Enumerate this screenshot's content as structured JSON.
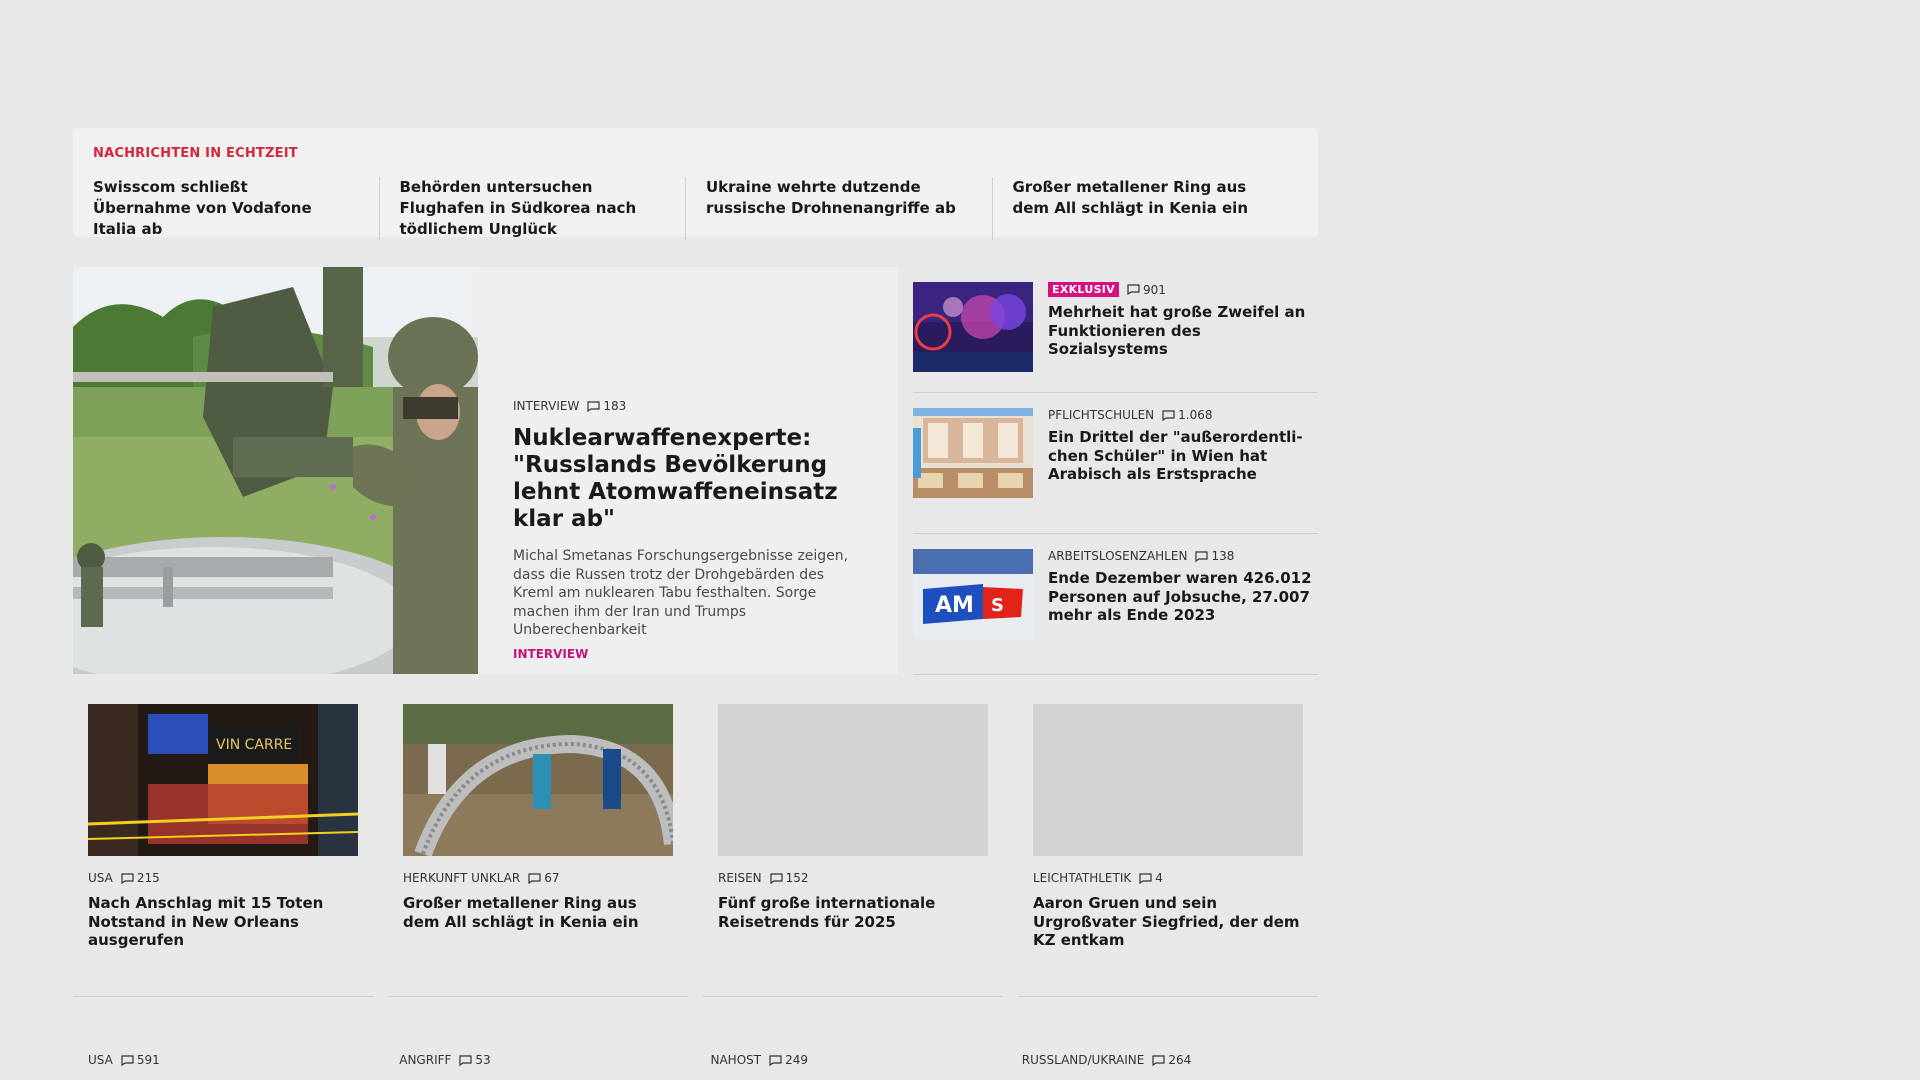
{
  "ticker": {
    "label": "NACHRICHTEN IN ECHTZEIT",
    "items": [
      "Swisscom schließt Übernahme von Vodafone Italia ab",
      "Behörden untersuchen Flughafen in Südkorea nach tödlichem Unglück",
      "Ukraine wehrte dutzende russische Drohnenangriffe ab",
      "Großer metallener Ring aus dem All schlägt in Kenia ein"
    ]
  },
  "hero": {
    "kicker": "INTERVIEW",
    "comments": "183",
    "title": "Nuklearwaffenexperte: \"Russlands Bevölkerung lehnt Atomwaffeneinsatz klar ab\"",
    "lead": "Michal Smetanas Forschungsergebnisse zeigen, dass die Russen trotz der Drohgebärden des Kreml am nuklearen Tabu festhalten. Sorge machen ihm der Iran und Trumps Unberechenbarkeit",
    "tag": "INTERVIEW"
  },
  "side": [
    {
      "badge": "EXKLUSIV",
      "kicker": "",
      "comments": "901",
      "title": "Mehrheit hat große Zweifel an Funktionieren des Sozialsystems"
    },
    {
      "badge": "",
      "kicker": "PFLICHTSCHULEN",
      "comments": "1.068",
      "title": "Ein Drittel der \"außerordentli-chen Schüler\" in Wien hat Arabisch als Erstsprache"
    },
    {
      "badge": "",
      "kicker": "ARBEITSLOSENZAHLEN",
      "comments": "138",
      "title": "Ende Dezember waren 426.012 Personen auf Jobsuche, 27.007 mehr als Ende 2023"
    }
  ],
  "cards": [
    {
      "kicker": "USA",
      "comments": "215",
      "title": "Nach Anschlag mit 15 Toten Notstand in New Orleans ausgerufen"
    },
    {
      "kicker": "HERKUNFT UNKLAR",
      "comments": "67",
      "title": "Großer metallener Ring aus dem All schlägt in Kenia ein"
    },
    {
      "kicker": "REISEN",
      "comments": "152",
      "title": "Fünf große internationale Reisetrends für 2025"
    },
    {
      "kicker": "LEICHTATHLETIK",
      "comments": "4",
      "title": "Aaron Gruen und sein Urgroßvater Siegfried, der dem KZ entkam"
    }
  ],
  "cards2": [
    {
      "kicker": "USA",
      "comments": "591"
    },
    {
      "kicker": "ANGRIFF",
      "comments": "53"
    },
    {
      "kicker": "NAHOST",
      "comments": "249"
    },
    {
      "kicker": "RUSSLAND/UKRAINE",
      "comments": "264"
    }
  ],
  "icons": {
    "comment": "comment-bubble-icon"
  },
  "colors": {
    "accent_red": "#d4283c",
    "accent_magenta": "#c4137f",
    "badge": "#d6107f"
  }
}
